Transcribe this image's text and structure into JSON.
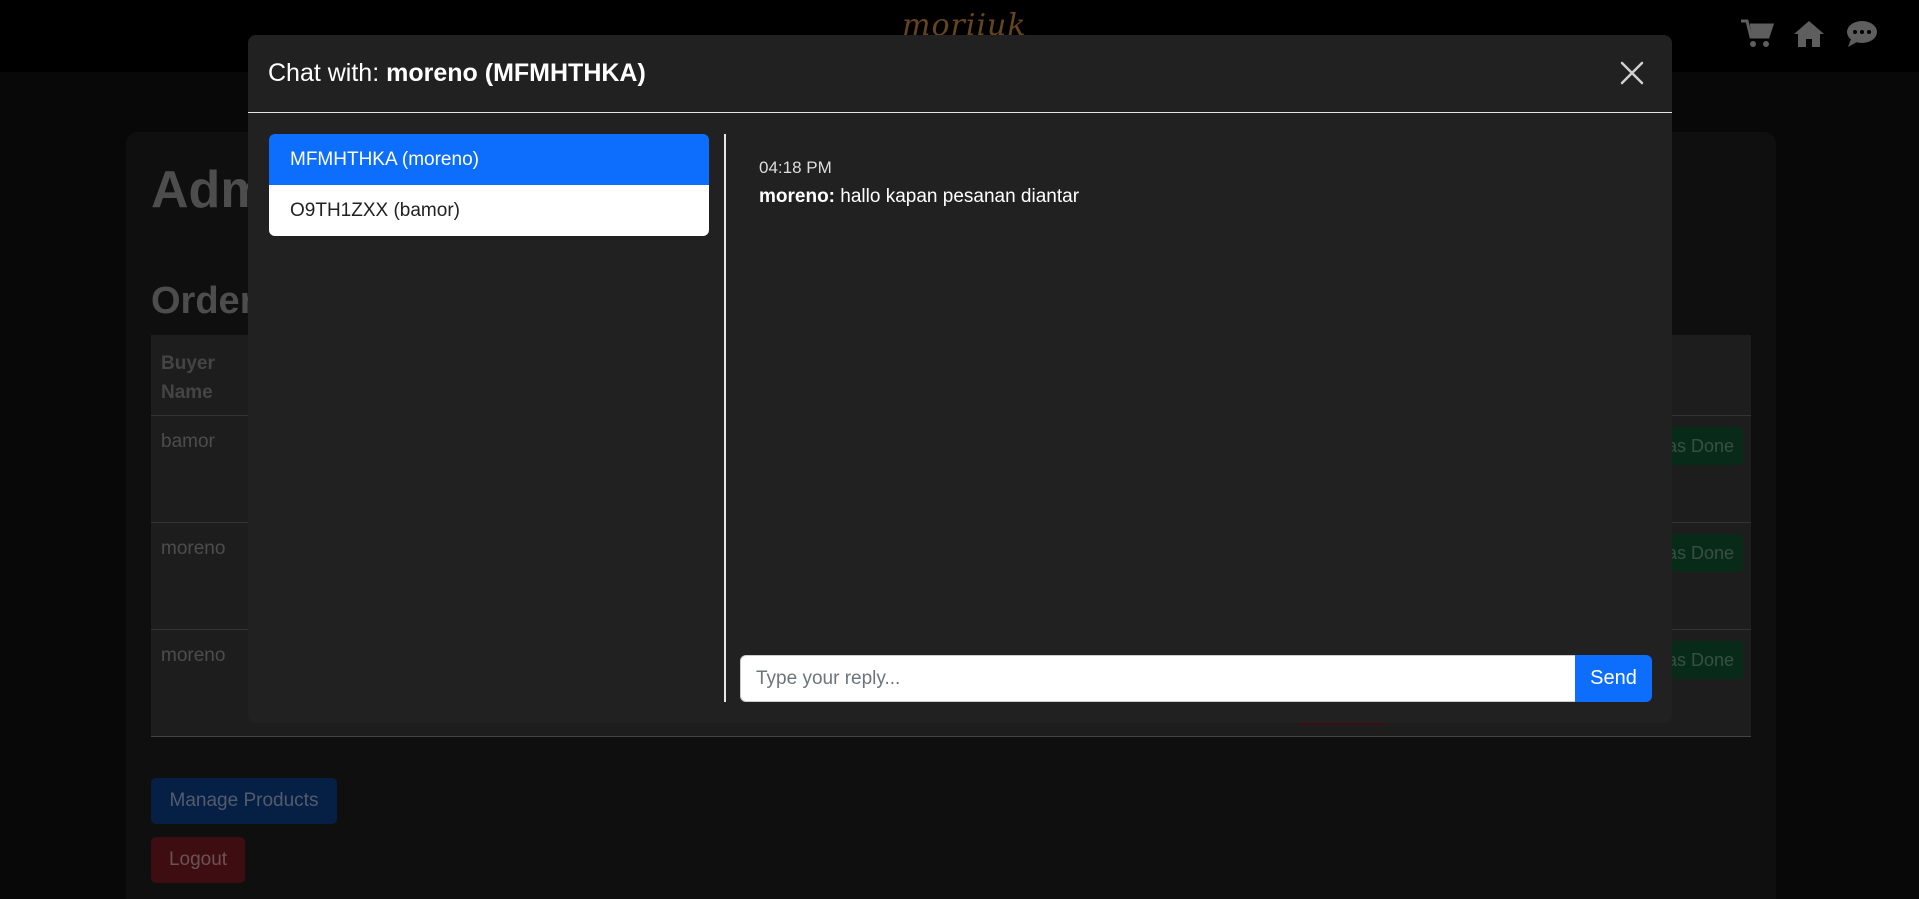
{
  "navbar": {
    "brand": "moriiuk",
    "icons": [
      "cart-icon",
      "home-icon",
      "chat-icon"
    ]
  },
  "page": {
    "admin_title": "Adm",
    "orders_title": "Order",
    "table": {
      "header": "Buyer Name",
      "rows": [
        {
          "buyer": "bamor",
          "action": "as Done"
        },
        {
          "buyer": "moreno",
          "action": "as Done"
        },
        {
          "buyer": "moreno",
          "action": "as Done"
        }
      ]
    },
    "manage_products_label": "Manage Products",
    "logout_label": "Logout"
  },
  "modal": {
    "title_prefix": "Chat with:",
    "title_name": "moreno (MFMHTHKA)",
    "conversations": [
      {
        "label": "MFMHTHKA (moreno)",
        "active": true
      },
      {
        "label": "O9TH1ZXX (bamor)",
        "active": false
      }
    ],
    "messages": [
      {
        "time": "04:18 PM",
        "sender": "moreno:",
        "text": "hallo kapan pesanan diantar"
      }
    ],
    "reply_placeholder": "Type your reply...",
    "send_label": "Send"
  },
  "colors": {
    "accent": "#0d6efd",
    "modal_bg": "#212121",
    "navbar_bg": "#000000",
    "brand": "#c98a3b"
  }
}
